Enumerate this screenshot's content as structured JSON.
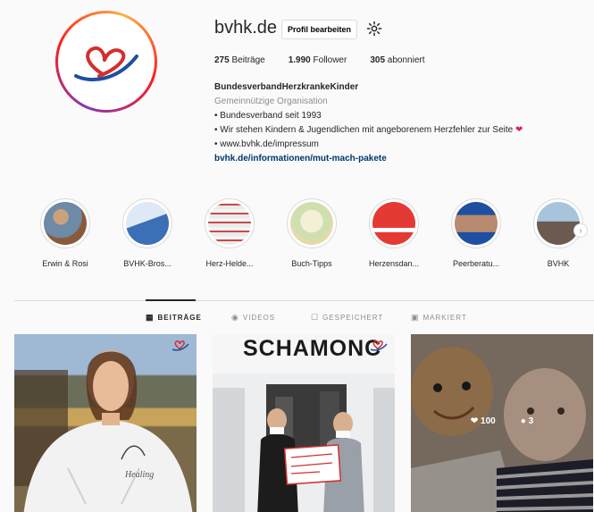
{
  "profile": {
    "username": "bvhk.de",
    "edit_label": "Profil bearbeiten",
    "stats": [
      {
        "count": "275",
        "label": "Beiträge"
      },
      {
        "count": "1.990",
        "label": "Follower"
      },
      {
        "count": "305",
        "label": "abonniert"
      }
    ],
    "fullname": "BundesverbandHerzkrankeKinder",
    "category": "Gemeinnützige Organisation",
    "bio_lines": [
      "• Bundesverband seit 1993",
      "• Wir stehen Kindern & Jugendlichen mit angeborenem Herzfehler zur Seite",
      "• www.bvhk.de/impressum"
    ],
    "link": "bvhk.de/informationen/mut-mach-pakete"
  },
  "highlights": [
    {
      "label": "Erwin & Rosi"
    },
    {
      "label": "BVHK-Bros..."
    },
    {
      "label": "Herz-Helde..."
    },
    {
      "label": "Buch-Tipps"
    },
    {
      "label": "Herzensdan..."
    },
    {
      "label": "Peerberatu..."
    },
    {
      "label": "BVHK"
    }
  ],
  "tabs": [
    {
      "label": "BEITRÄGE"
    },
    {
      "label": "VIDEOS"
    },
    {
      "label": "GESPEICHERT"
    },
    {
      "label": "MARKIERT"
    }
  ],
  "posts": [
    {
      "sign_text": ""
    },
    {
      "sign_text": "SCHAMONC"
    },
    {
      "likes": "100",
      "comments": "3"
    }
  ],
  "colors": {
    "link": "#00376b",
    "heart": "#e0245e",
    "accent_red": "#d32f2f",
    "accent_blue": "#1e4fa0"
  }
}
